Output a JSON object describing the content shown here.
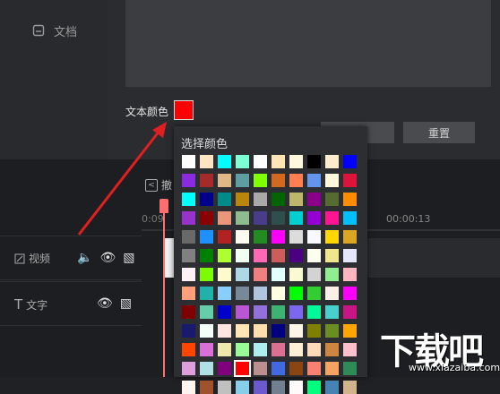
{
  "sidebar": {
    "doc_label": "文档"
  },
  "settings": {
    "text_color_label": "文本颜色",
    "selected_color": "#ff0000",
    "reset_label": "重置"
  },
  "toolbar": {
    "undo_label": "撤"
  },
  "timeline": {
    "time_start": "0:09",
    "time_13": "00:00:13"
  },
  "tracks": [
    {
      "label": "视频",
      "name": "video"
    },
    {
      "label": "文字",
      "name": "text"
    }
  ],
  "picker": {
    "title": "选择颜色",
    "colors": [
      "#ffffff",
      "#ffe4c4",
      "#00ffff",
      "#7fffd4",
      "#ffffff",
      "#ffe4b5",
      "#fff8dc",
      "#000000",
      "#ffebcd",
      "#0000ff",
      "#8a2be2",
      "#a52a2a",
      "#deb887",
      "#5f9ea0",
      "#7fff00",
      "#d2691e",
      "#ff7f50",
      "#6495ed",
      "#fff8dc",
      "#dc143c",
      "#00ffff",
      "#00008b",
      "#008b8b",
      "#b8860b",
      "#a9a9a9",
      "#006400",
      "#bdb76b",
      "#8b008b",
      "#556b2f",
      "#ff8c00",
      "#9932cc",
      "#8b0000",
      "#e9967a",
      "#8fbc8f",
      "#483d8b",
      "#2f4f4f",
      "#00ced1",
      "#9400d3",
      "#ff1493",
      "#00bfff",
      "#696969",
      "#1e90ff",
      "#b22222",
      "#fffaf0",
      "#228b22",
      "#ff00ff",
      "#dcdcdc",
      "#f8f8ff",
      "#ffd700",
      "#daa520",
      "#808080",
      "#008000",
      "#adff2f",
      "#f0fff0",
      "#ff69b4",
      "#cd5c5c",
      "#4b0082",
      "#fffff0",
      "#f0e68c",
      "#e6e6fa",
      "#fff0f5",
      "#7cfc00",
      "#fffacd",
      "#add8e6",
      "#f08080",
      "#e0ffff",
      "#fafad2",
      "#d3d3d3",
      "#90ee90",
      "#ffb6c1",
      "#ffa07a",
      "#20b2aa",
      "#87cefa",
      "#778899",
      "#b0c4de",
      "#ffffe0",
      "#00ff00",
      "#32cd32",
      "#faf0e6",
      "#ff00ff",
      "#800000",
      "#66cdaa",
      "#0000cd",
      "#ba55d3",
      "#9370db",
      "#3cb371",
      "#7b68ee",
      "#00fa9a",
      "#48d1cc",
      "#c71585",
      "#191970",
      "#f5fffa",
      "#ffe4e1",
      "#ffe4b5",
      "#ffdead",
      "#000080",
      "#fdf5e6",
      "#808000",
      "#6b8e23",
      "#ffa500",
      "#ff4500",
      "#da70d6",
      "#eee8aa",
      "#98fb98",
      "#afeeee",
      "#db7093",
      "#ffefd5",
      "#ffdab9",
      "#cd853f",
      "#ffc0cb",
      "#dda0dd",
      "#b0e0e6",
      "#800080",
      "#ff0000",
      "#bc8f8f",
      "#4169e1",
      "#8b4513",
      "#fa8072",
      "#f4a460",
      "#2e8b57",
      "#fff5ee",
      "#a0522d",
      "#c0c0c0",
      "#87ceeb",
      "#6a5acd",
      "#708090",
      "#fffafa",
      "#00ff7f",
      "#4682b4",
      "#d2b48c"
    ],
    "selected_index": 113
  },
  "watermark": {
    "text": "下载吧",
    "url": "www.xiazaiba.com"
  }
}
